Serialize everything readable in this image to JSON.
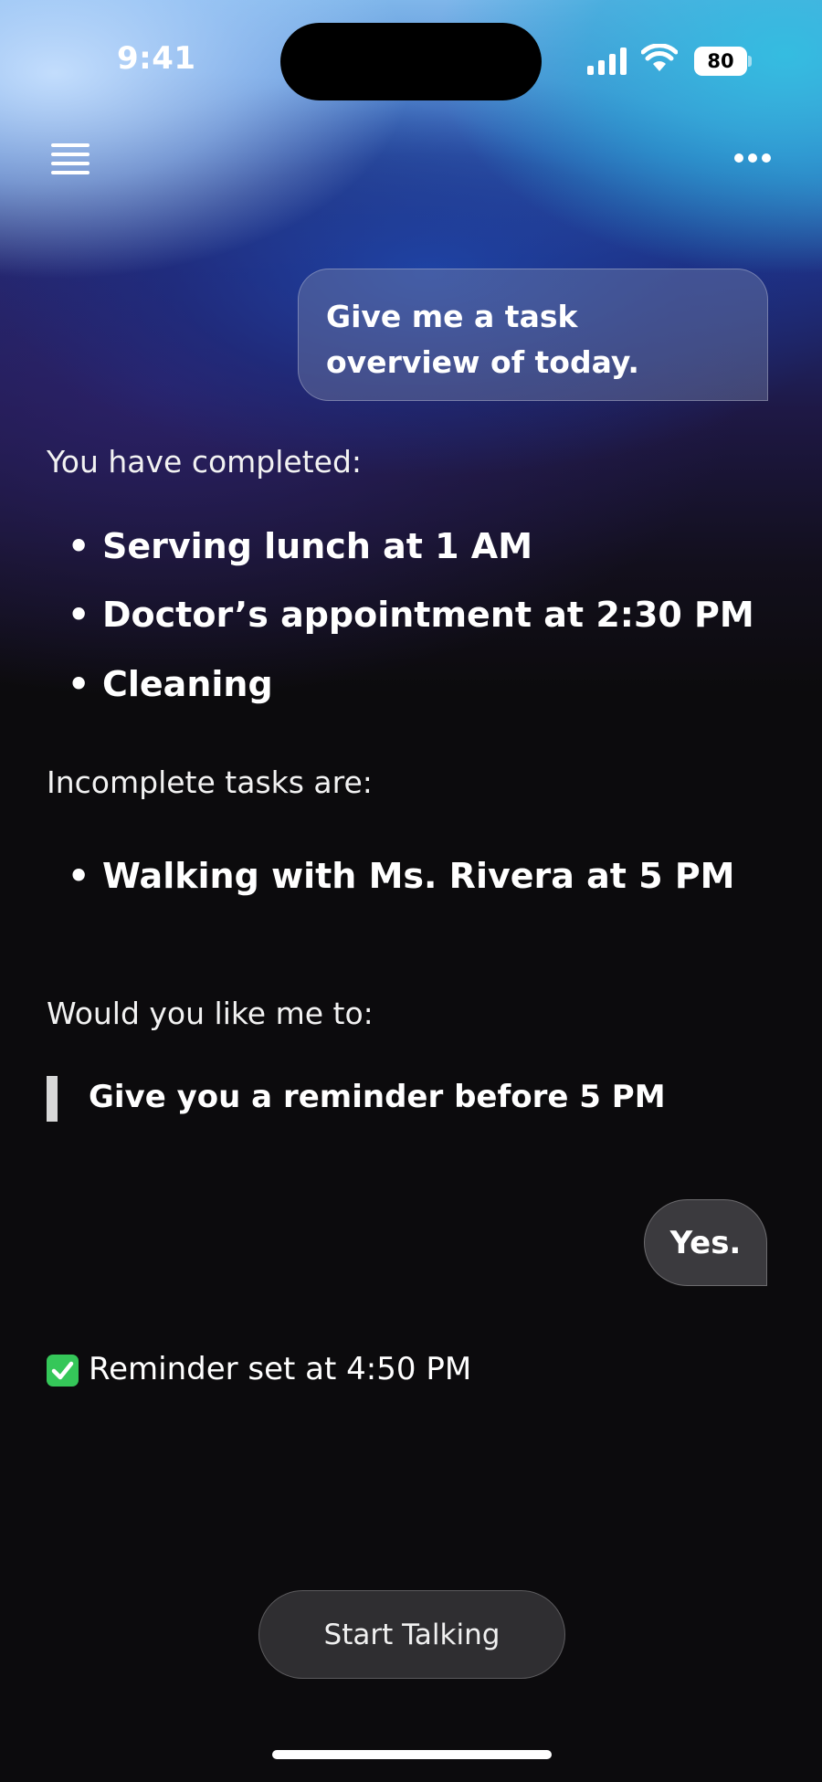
{
  "status_bar": {
    "time": "9:41",
    "battery": "80"
  },
  "nav": {
    "menu_icon": "hamburger-icon",
    "more_icon": "ellipsis-icon"
  },
  "chat": {
    "user_message_1": "Give me a task overview of today.",
    "completed_heading": "You have completed:",
    "completed_items": [
      "Serving lunch at 1 AM",
      "Doctor’s appointment at 2:30 PM",
      "Cleaning"
    ],
    "incomplete_heading": "Incomplete tasks are:",
    "incomplete_items": [
      "Walking with Ms. Rivera at 5 PM"
    ],
    "question": "Would you like me to:",
    "option": "Give you a reminder before 5 PM",
    "user_message_2": "Yes.",
    "confirmation": "Reminder set at 4:50 PM",
    "confirmation_icon": "check-mark-icon"
  },
  "actions": {
    "start_talking": "Start Talking"
  },
  "colors": {
    "background": "#0c0b0d",
    "check_green": "#35c759",
    "button_bg": "#2f2e31"
  }
}
